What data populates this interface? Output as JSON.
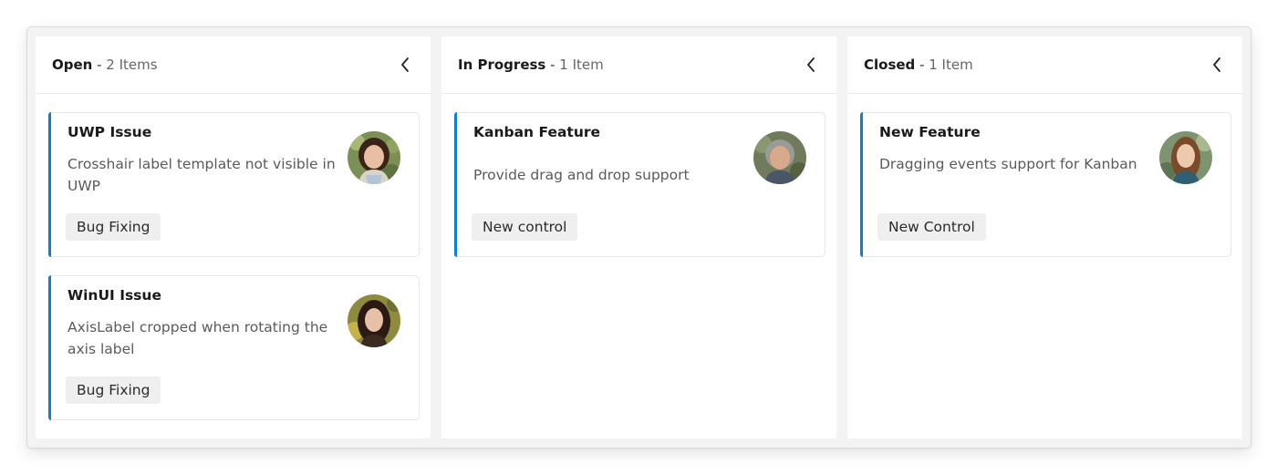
{
  "columns": [
    {
      "name": "Open",
      "separator": " - ",
      "count_text": "2 Items",
      "cards": [
        {
          "title": "UWP Issue",
          "description": "Crosshair label template not visible in UWP",
          "tag": "Bug Fixing",
          "avatar": "woman-smiling-avatar"
        },
        {
          "title": "WinUI Issue",
          "description": "AxisLabel cropped when rotating the axis label",
          "tag": "Bug Fixing",
          "avatar": "woman-dark-hair-avatar"
        }
      ]
    },
    {
      "name": "In Progress",
      "separator": " - ",
      "count_text": "1 Item",
      "cards": [
        {
          "title": "Kanban Feature",
          "description": "Provide drag and drop support",
          "tag": "New control",
          "avatar": "woman-gray-hair-avatar"
        }
      ]
    },
    {
      "name": "Closed",
      "separator": " - ",
      "count_text": "1 Item",
      "cards": [
        {
          "title": "New Feature",
          "description": "Dragging events support for Kanban",
          "tag": "New Control",
          "avatar": "woman-long-hair-avatar"
        }
      ]
    }
  ],
  "icons": {
    "collapse": "chevron-left-icon"
  },
  "colors": {
    "card_accent": "#0f7ed6",
    "board_background": "#f3f3f3",
    "tag_background": "#efefef"
  }
}
